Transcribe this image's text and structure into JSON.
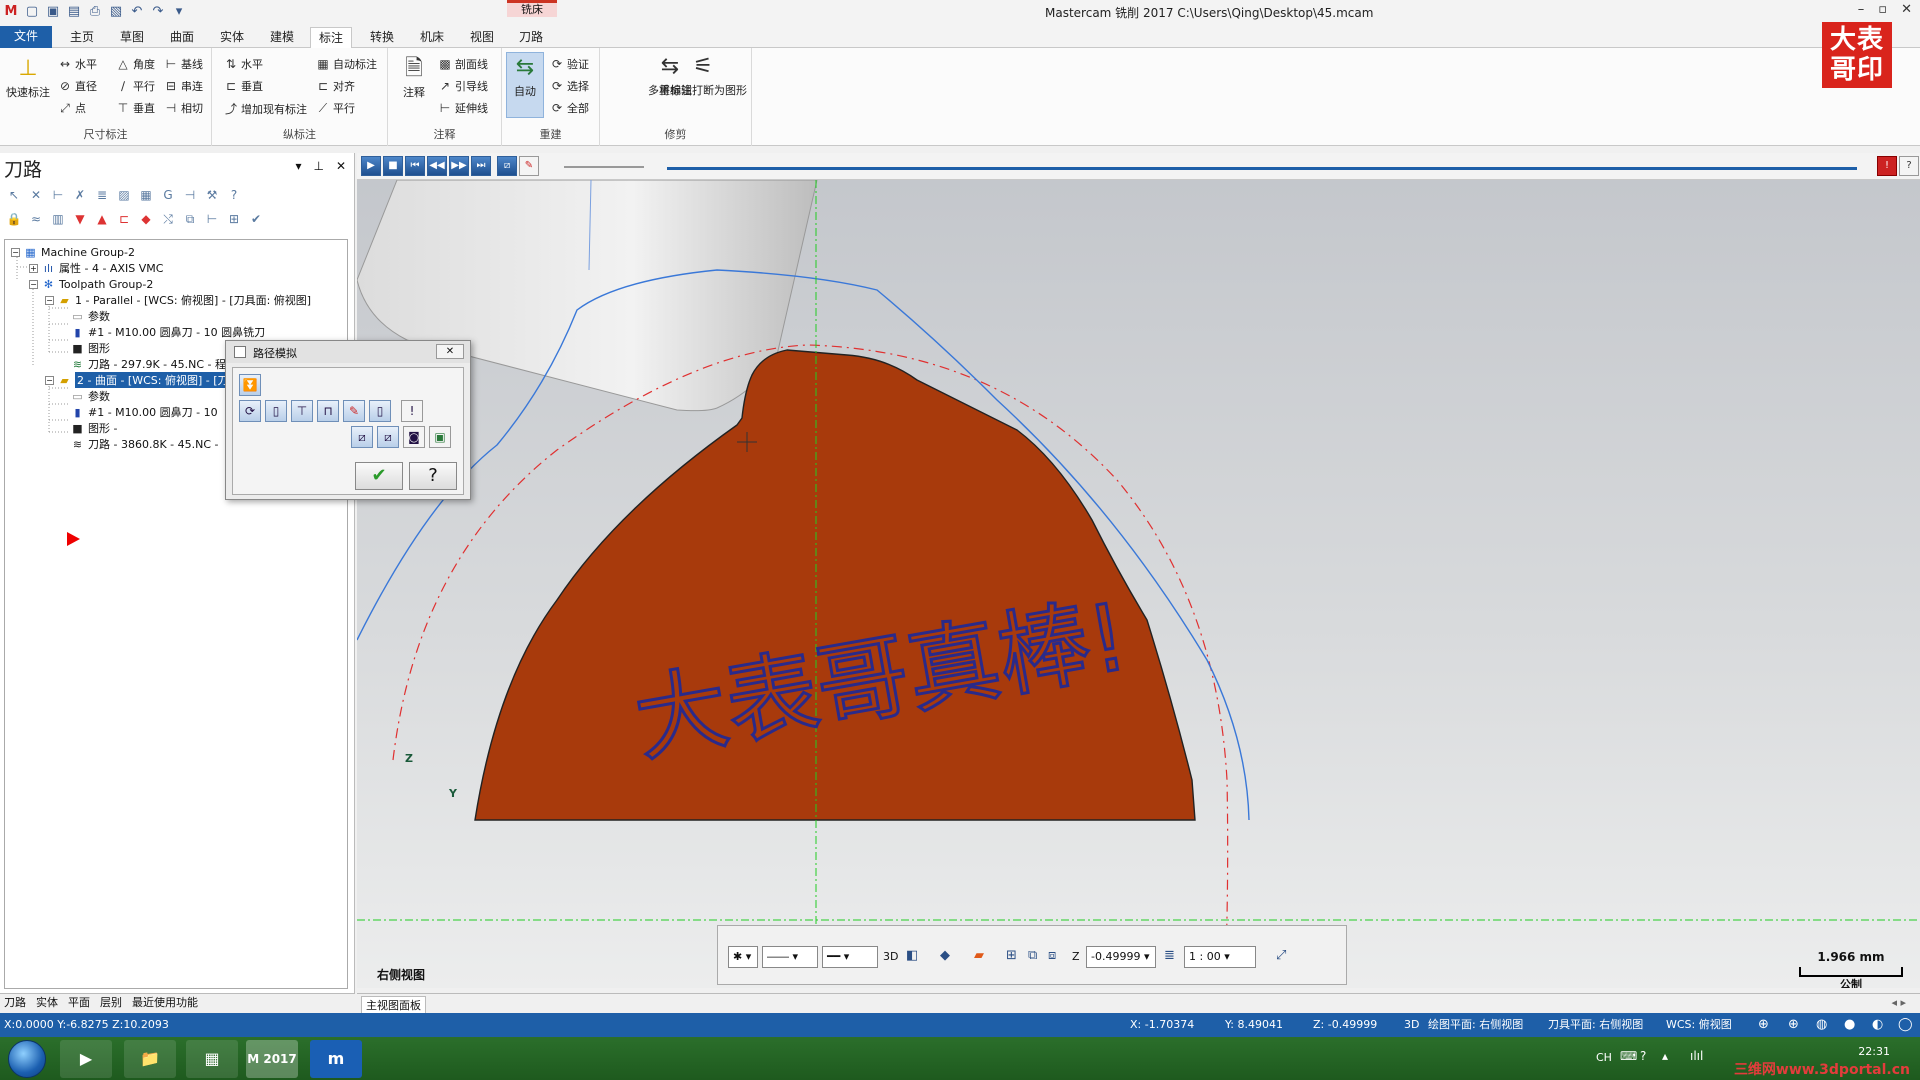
{
  "window": {
    "title": "Mastercam 铣削 2017  C:\\Users\\Qing\\Desktop\\45.mcam",
    "context_tab_group": "铣床",
    "controls": [
      "–",
      "▫",
      "✕"
    ]
  },
  "tabs": [
    "文件",
    "主页",
    "草图",
    "曲面",
    "实体",
    "建模",
    "标注",
    "转换",
    "机床",
    "视图",
    "刀路"
  ],
  "ribbon": {
    "dimension": {
      "label": "尺寸标注",
      "quick": "快速标注",
      "items": [
        "水平",
        "角度",
        "基线",
        "直径",
        "平行",
        "串连",
        "点",
        "垂直",
        "相切"
      ]
    },
    "ordinate": {
      "label": "纵标注",
      "items": [
        "水平",
        "自动标注",
        "垂直",
        "对齐",
        "增加现有标注",
        "平行"
      ]
    },
    "annotation": {
      "label": "注释",
      "note": "注释",
      "items": [
        "剖面线",
        "引导线",
        "延伸线"
      ]
    },
    "regen": {
      "label": "重建",
      "auto": "自动",
      "items": [
        "验证",
        "选择",
        "全部"
      ]
    },
    "modify": {
      "label": "修剪",
      "items": [
        "多重编辑",
        "将标注打断为图形"
      ]
    }
  },
  "stamp": "大表哥印",
  "left_panel": {
    "title": "刀路",
    "tree": [
      "Machine Group-2",
      "属性 - 4 - AXIS VMC",
      "Toolpath Group-2",
      "1 - Parallel - [WCS: 俯视图] - [刀具面: 俯视图]",
      "参数",
      "#1 - M10.00 圆鼻刀 - 10 圆鼻铣刀",
      "图形",
      "刀路 - 297.9K - 45.NC - 程",
      "2 - 曲面 - [WCS: 俯视图] - [刀具",
      "参数",
      "#1 - M10.00 圆鼻刀 - 10",
      "图形 -",
      "刀路 - 3860.8K - 45.NC -"
    ],
    "bottom_tabs": [
      "刀路",
      "实体",
      "平面",
      "层别",
      "最近使用功能"
    ]
  },
  "dialog": {
    "title": "路径模拟",
    "close": "✕",
    "ok": "✔",
    "help": "?"
  },
  "viewport": {
    "engraving_text": "大表哥真棒!",
    "view_label": "右侧视图",
    "axis_z": "Z",
    "axis_y": "Y",
    "scale_value": "1.966 mm",
    "scale_unit": "公制",
    "z_value": "-0.49999",
    "z_label": "Z",
    "scale_ratio": "1 : 00",
    "mode_3d": "3D",
    "colors": {
      "part": "#a83a0c",
      "toolpath": "#3a78d8",
      "engrave": "#2a2a8a",
      "dashed": "#e03030",
      "guide": "#22cc22"
    }
  },
  "mode_tab": "主视图面板",
  "status": {
    "left": "X:0.0000  Y:-6.8275  Z:10.2093",
    "x": "X:   -1.70374",
    "y": "Y:   8.49041",
    "z": "Z:   -0.49999",
    "d3": "3D",
    "plane": "绘图平面: 右侧视图",
    "tool_plane": "刀具平面: 右侧视图",
    "wcs": "WCS: 俯视图"
  },
  "taskbar": {
    "apps": [
      "▶",
      "📁",
      "▦",
      "M 2017",
      "m"
    ],
    "lang": "CH",
    "time": "22:31",
    "watermark": "三维网www.3dportal.cn"
  }
}
